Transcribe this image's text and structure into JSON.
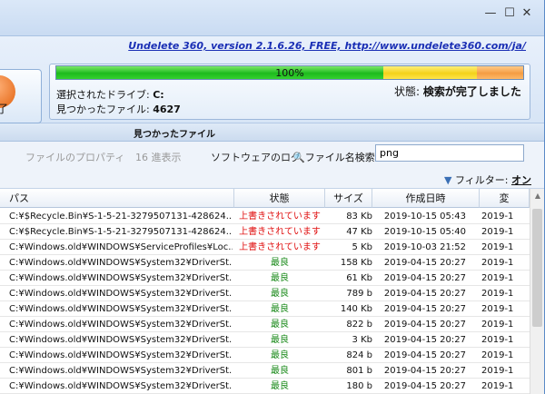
{
  "window": {
    "minimize": "—",
    "maximize": "☐",
    "close": "✕",
    "link_text": "Undelete 360, version 2.1.6.26, FREE, http://www.undelete360.com/ja/"
  },
  "toolbar": {
    "action_label": "了"
  },
  "progress": {
    "label": "100%",
    "value": 1.0,
    "green_fraction": 0.7,
    "yellow_fraction": 0.2,
    "orange_fraction": 0.1
  },
  "scan": {
    "drive_label": "選択されたドライブ:",
    "drive_value": "C:",
    "found_label": "見つかったファイル:",
    "found_value": "4627",
    "state_label": "状態:",
    "state_value": "検索が完了しました"
  },
  "section": {
    "title": "見つかったファイル"
  },
  "tabs": [
    {
      "label": "ファイルのプロパティ",
      "active": false
    },
    {
      "label": "16 進表示",
      "active": false
    },
    {
      "label": "ソフトウェアのログ",
      "active": true
    }
  ],
  "search": {
    "label": "ファイル名検索:",
    "value": "png"
  },
  "filter": {
    "label": "フィルター:",
    "value": "オン"
  },
  "table": {
    "columns": [
      "パス",
      "状態",
      "サイズ",
      "作成日時",
      "変"
    ],
    "rows": [
      {
        "prefix": "",
        "path": "C:¥$Recycle.Bin¥S-1-5-21-3279507131-428624...",
        "status": "上書きされています",
        "status_type": "bad",
        "size": "83 Kb",
        "date": "2019-10-15 05:43",
        "extra": "2019-1"
      },
      {
        "prefix": "",
        "path": "C:¥$Recycle.Bin¥S-1-5-21-3279507131-428624...",
        "status": "上書きされています",
        "status_type": "bad",
        "size": "47 Kb",
        "date": "2019-10-15 05:40",
        "extra": "2019-1"
      },
      {
        "prefix": "",
        "path": "C:¥Windows.old¥WINDOWS¥ServiceProfiles¥Loc...",
        "status": "上書きされています",
        "status_type": "bad",
        "size": "5 Kb",
        "date": "2019-10-03 21:52",
        "extra": "2019-1"
      },
      {
        "prefix": "",
        "path": "C:¥Windows.old¥WINDOWS¥System32¥DriverSt...",
        "status": "最良",
        "status_type": "good",
        "size": "158 Kb",
        "date": "2019-04-15 20:27",
        "extra": "2019-1"
      },
      {
        "prefix": "",
        "path": "C:¥Windows.old¥WINDOWS¥System32¥DriverSt...",
        "status": "最良",
        "status_type": "good",
        "size": "61 Kb",
        "date": "2019-04-15 20:27",
        "extra": "2019-1"
      },
      {
        "prefix": "",
        "path": "C:¥Windows.old¥WINDOWS¥System32¥DriverSt...",
        "status": "最良",
        "status_type": "good",
        "size": "789 b",
        "date": "2019-04-15 20:27",
        "extra": "2019-1"
      },
      {
        "prefix": "",
        "path": "C:¥Windows.old¥WINDOWS¥System32¥DriverSt...",
        "status": "最良",
        "status_type": "good",
        "size": "140 Kb",
        "date": "2019-04-15 20:27",
        "extra": "2019-1"
      },
      {
        "prefix": "",
        "path": "C:¥Windows.old¥WINDOWS¥System32¥DriverSt...",
        "status": "最良",
        "status_type": "good",
        "size": "822 b",
        "date": "2019-04-15 20:27",
        "extra": "2019-1"
      },
      {
        "prefix": "",
        "path": "C:¥Windows.old¥WINDOWS¥System32¥DriverSt...",
        "status": "最良",
        "status_type": "good",
        "size": "3 Kb",
        "date": "2019-04-15 20:27",
        "extra": "2019-1"
      },
      {
        "prefix": "",
        "path": "C:¥Windows.old¥WINDOWS¥System32¥DriverSt...",
        "status": "最良",
        "status_type": "good",
        "size": "824 b",
        "date": "2019-04-15 20:27",
        "extra": "2019-1"
      },
      {
        "prefix": "",
        "path": "C:¥Windows.old¥WINDOWS¥System32¥DriverSt...",
        "status": "最良",
        "status_type": "good",
        "size": "801 b",
        "date": "2019-04-15 20:27",
        "extra": "2019-1"
      },
      {
        "prefix": "",
        "path": "C:¥Windows.old¥WINDOWS¥System32¥DriverSt...",
        "status": "最良",
        "status_type": "good",
        "size": "180 b",
        "date": "2019-04-15 20:27",
        "extra": "2019-1"
      }
    ]
  },
  "colors": {
    "status_bad": "#e01010",
    "status_good": "#1a8a1a",
    "link": "#1a2fb5"
  }
}
